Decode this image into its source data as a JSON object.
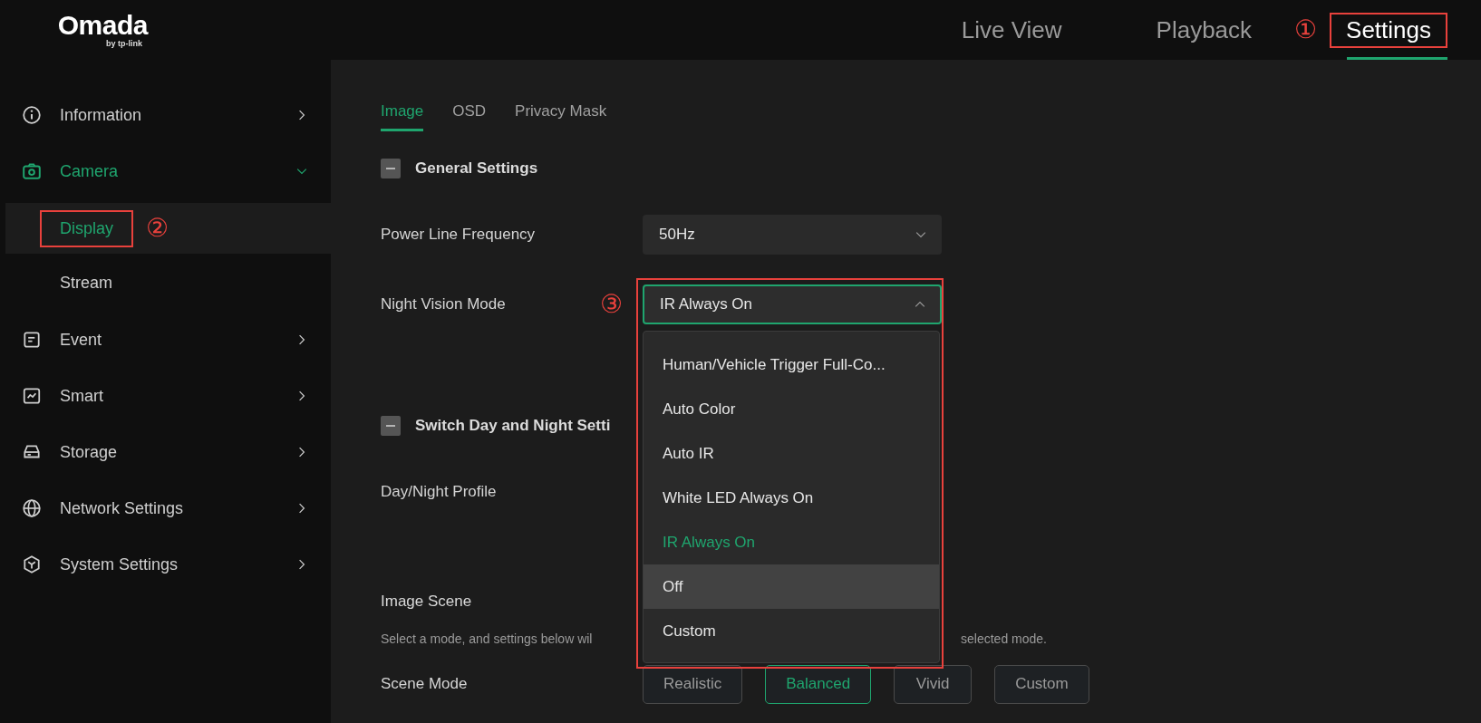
{
  "logo": {
    "name": "Omada",
    "tagline": "by tp-link"
  },
  "nav": [
    {
      "label": "Live View",
      "selected": false
    },
    {
      "label": "Playback",
      "selected": false
    },
    {
      "label": "Settings",
      "selected": true,
      "annotation": "①"
    }
  ],
  "sidebar": {
    "items": [
      {
        "label": "Information",
        "selected": false,
        "expanded": false
      },
      {
        "label": "Camera",
        "selected": true,
        "expanded": true,
        "children": [
          {
            "label": "Display",
            "selected": true,
            "annotation": "②"
          },
          {
            "label": "Stream",
            "selected": false
          }
        ]
      },
      {
        "label": "Event",
        "selected": false,
        "expanded": false
      },
      {
        "label": "Smart",
        "selected": false,
        "expanded": false
      },
      {
        "label": "Storage",
        "selected": false,
        "expanded": false
      },
      {
        "label": "Network Settings",
        "selected": false,
        "expanded": false
      },
      {
        "label": "System Settings",
        "selected": false,
        "expanded": false
      }
    ]
  },
  "tabs": [
    {
      "label": "Image",
      "selected": true
    },
    {
      "label": "OSD",
      "selected": false
    },
    {
      "label": "Privacy Mask",
      "selected": false
    }
  ],
  "general_settings": {
    "title": "General Settings",
    "expanded": true,
    "fields": [
      {
        "label": "Power Line Frequency",
        "value": "50Hz",
        "open": false
      },
      {
        "label": "Night Vision Mode",
        "value": "IR Always On",
        "open": true,
        "annotation": "③",
        "options": [
          {
            "label": "Human/Vehicle Trigger Full-Co...",
            "selected": false,
            "hovered": false
          },
          {
            "label": "Auto Color",
            "selected": false,
            "hovered": false
          },
          {
            "label": "Auto IR",
            "selected": false,
            "hovered": false
          },
          {
            "label": "White LED Always On",
            "selected": false,
            "hovered": false
          },
          {
            "label": "IR Always On",
            "selected": true,
            "hovered": false
          },
          {
            "label": "Off",
            "selected": false,
            "hovered": true
          },
          {
            "label": "Custom",
            "selected": false,
            "hovered": false
          }
        ]
      }
    ]
  },
  "switch_day_night": {
    "title": "Switch Day and Night Setti",
    "expanded": true,
    "fields": [
      {
        "label": "Day/Night Profile"
      }
    ]
  },
  "image_scene": {
    "title": "Image Scene",
    "description_start": "Select a mode, and settings below wil",
    "description_end": "selected mode.",
    "scene_mode": {
      "label": "Scene Mode",
      "options": [
        {
          "label": "Realistic",
          "selected": false
        },
        {
          "label": "Balanced",
          "selected": true
        },
        {
          "label": "Vivid",
          "selected": false
        },
        {
          "label": "Custom",
          "selected": false
        }
      ]
    }
  }
}
